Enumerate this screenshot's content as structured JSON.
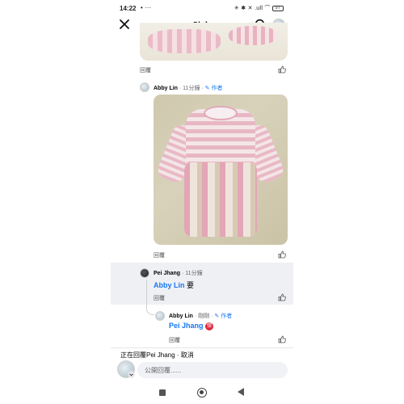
{
  "status_bar": {
    "time": "14:22",
    "notif": "• ···",
    "system": "✳ ✱ ✕ .ull ⌒",
    "battery": "97"
  },
  "header": {
    "title": "貼文"
  },
  "top_post": {
    "reply_label": "回覆"
  },
  "comment1": {
    "author": "Abby Lin",
    "time": " · 11分鐘 · ",
    "author_tag": "✎ 作者",
    "reply_label": "回覆"
  },
  "comment2": {
    "author": "Pei Jhang",
    "time": " · 11分鐘",
    "mention": "Abby Lin",
    "text": " 要",
    "reply_label": "回覆"
  },
  "comment3": {
    "author": "Abby Lin",
    "time": " · 剛剛 · ",
    "author_tag": "✎ 作者",
    "mention": "Pei Jhang",
    "badge": "彈",
    "reply_label": "回覆"
  },
  "composer": {
    "replying_prefix": "正在回覆",
    "replying_to": "Pei Jhang",
    "separator": " · ",
    "cancel": "取消",
    "placeholder": "公開回覆......"
  },
  "colors": {
    "accent": "#1877f2",
    "highlight_bg": "#eef0f4",
    "badge": "#e0263a"
  }
}
